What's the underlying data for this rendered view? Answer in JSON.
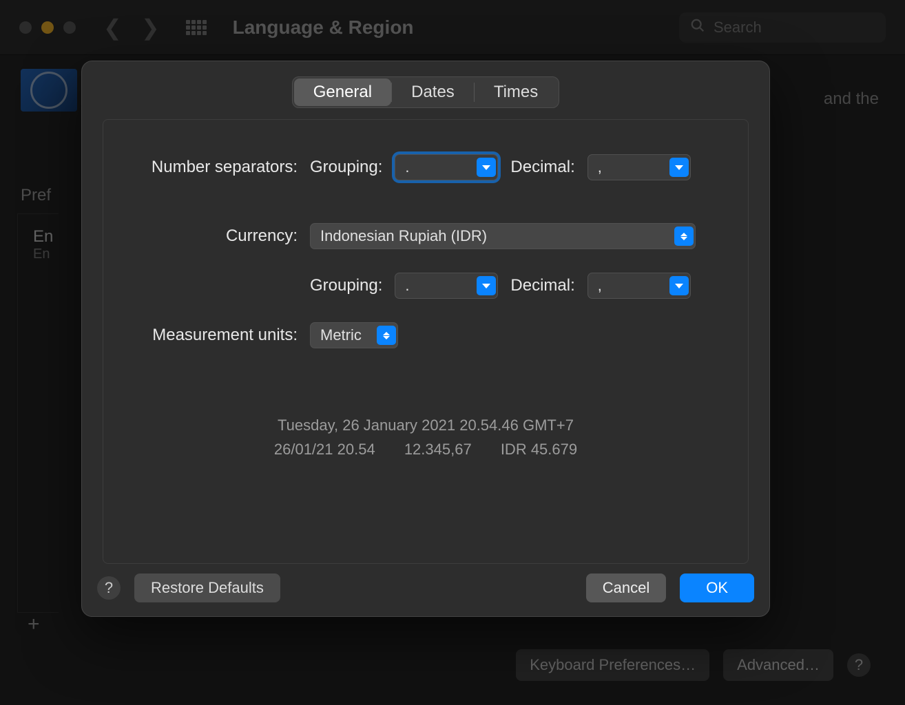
{
  "window": {
    "title": "Language & Region",
    "search_placeholder": "Search"
  },
  "background": {
    "and_the": "and the",
    "preferred": "Pref",
    "lang_main": "En",
    "lang_sub": "En",
    "plus": "+",
    "keyboard_btn": "Keyboard Preferences…",
    "advanced_btn": "Advanced…",
    "help": "?"
  },
  "sheet": {
    "tabs": [
      "General",
      "Dates",
      "Times"
    ],
    "active_tab": 0,
    "labels": {
      "number_separators": "Number separators:",
      "grouping": "Grouping:",
      "decimal": "Decimal:",
      "currency": "Currency:",
      "measurement": "Measurement units:"
    },
    "values": {
      "num_grouping": ".",
      "num_decimal": ",",
      "currency": "Indonesian Rupiah (IDR)",
      "cur_grouping": ".",
      "cur_decimal": ",",
      "measurement": "Metric"
    },
    "preview": {
      "line1": "Tuesday, 26 January 2021 20.54.46 GMT+7",
      "part_date": "26/01/21 20.54",
      "part_num": "12.345,67",
      "part_cur": "IDR 45.679"
    },
    "buttons": {
      "help": "?",
      "restore": "Restore Defaults",
      "cancel": "Cancel",
      "ok": "OK"
    }
  }
}
